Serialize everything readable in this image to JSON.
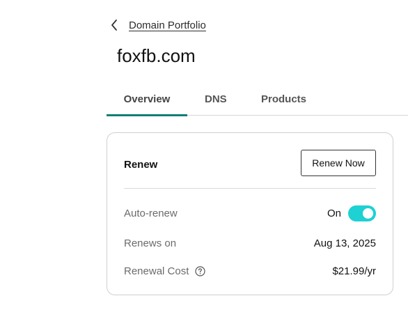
{
  "breadcrumb": {
    "back_icon": "chevron-left-icon",
    "link_label": "Domain Portfolio"
  },
  "page": {
    "title": "foxfb.com"
  },
  "tabs": [
    {
      "label": "Overview",
      "active": true
    },
    {
      "label": "DNS",
      "active": false
    },
    {
      "label": "Products",
      "active": false
    }
  ],
  "renew_card": {
    "title": "Renew",
    "renew_button_label": "Renew Now",
    "rows": {
      "auto_renew": {
        "label": "Auto-renew",
        "value": "On",
        "toggle_on": true
      },
      "renews_on": {
        "label": "Renews on",
        "value": "Aug 13, 2025"
      },
      "renewal_cost": {
        "label": "Renewal Cost",
        "value": "$21.99/yr",
        "help_icon": "question-circle-icon"
      }
    }
  },
  "colors": {
    "tab_underline": "#0e7f73",
    "toggle_on": "#1ed1d3"
  }
}
